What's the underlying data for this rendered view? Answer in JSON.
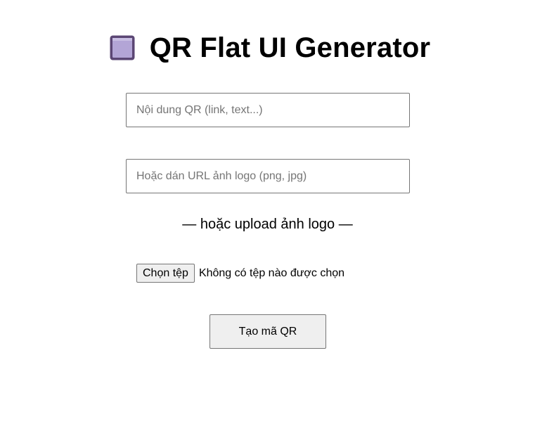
{
  "header": {
    "icon": "purple-square-icon",
    "icon_color": "#b3a5d6",
    "icon_border_color": "#5b4674",
    "title": "QR Flat UI Generator"
  },
  "form": {
    "qr_content": {
      "value": "",
      "placeholder": "Nội dung QR (link, text...)"
    },
    "logo_url": {
      "value": "",
      "placeholder": "Hoặc dán URL ảnh logo (png, jpg)"
    },
    "divider_text": "— hoặc upload ảnh logo —",
    "file_upload": {
      "button_label": "Chọn tệp",
      "status_text": "Không có tệp nào được chọn"
    },
    "submit_label": "Tạo mã QR"
  }
}
